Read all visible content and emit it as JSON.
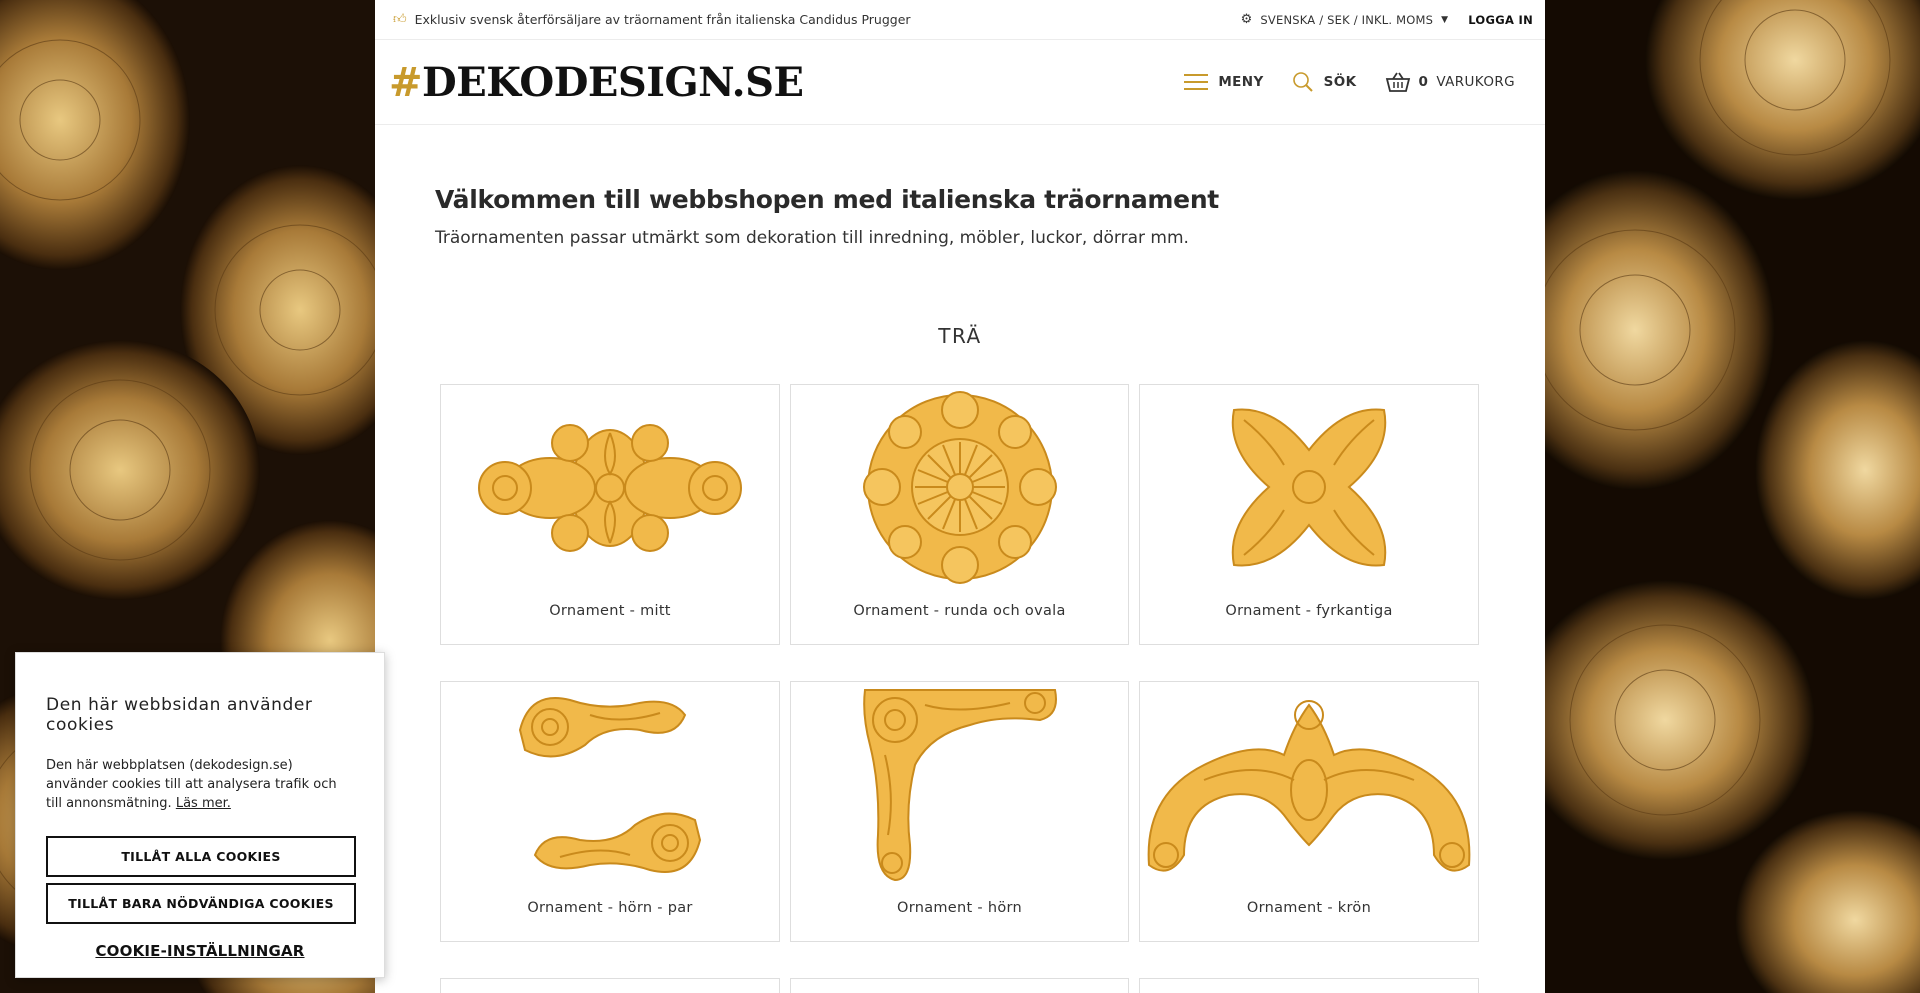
{
  "topbar": {
    "promo_icon": "thumbs-up-icon",
    "promo_text": "Exklusiv svensk återförsäljare av träornament från italienska Candidus Prugger",
    "language": "SVENSKA / SEK / INKL. MOMS",
    "login": "LOGGA IN"
  },
  "header": {
    "logo_hash": "#",
    "logo_text": "DEKODESIGN.SE",
    "menu_label": "MENY",
    "search_label": "SÖK",
    "cart_count": "0",
    "cart_label": "VARUKORG"
  },
  "intro": {
    "title": "Välkommen till webbshopen med italienska träornament",
    "subtitle": "Träornamenten passar utmärkt som dekoration till inredning, möbler, luckor, dörrar mm."
  },
  "section": {
    "title": "TRÄ"
  },
  "categories": [
    {
      "label": "Ornament - mitt"
    },
    {
      "label": "Ornament - runda och ovala"
    },
    {
      "label": "Ornament - fyrkantiga"
    },
    {
      "label": "Ornament - hörn - par"
    },
    {
      "label": "Ornament - hörn"
    },
    {
      "label": "Ornament - krön"
    }
  ],
  "cookie": {
    "title": "Den här webbsidan använder cookies",
    "text": "Den här webbplatsen (dekodesign.se) använder cookies till att analysera trafik och till annonsmätning.",
    "read_more": "Läs mer.",
    "allow_all": "TILLÅT ALLA COOKIES",
    "allow_necessary": "TILLÅT BARA NÖDVÄNDIGA COOKIES",
    "settings": "COOKIE-INSTÄLLNINGAR"
  },
  "colors": {
    "accent": "#c89a2c",
    "ornament": "#f1b94a"
  }
}
